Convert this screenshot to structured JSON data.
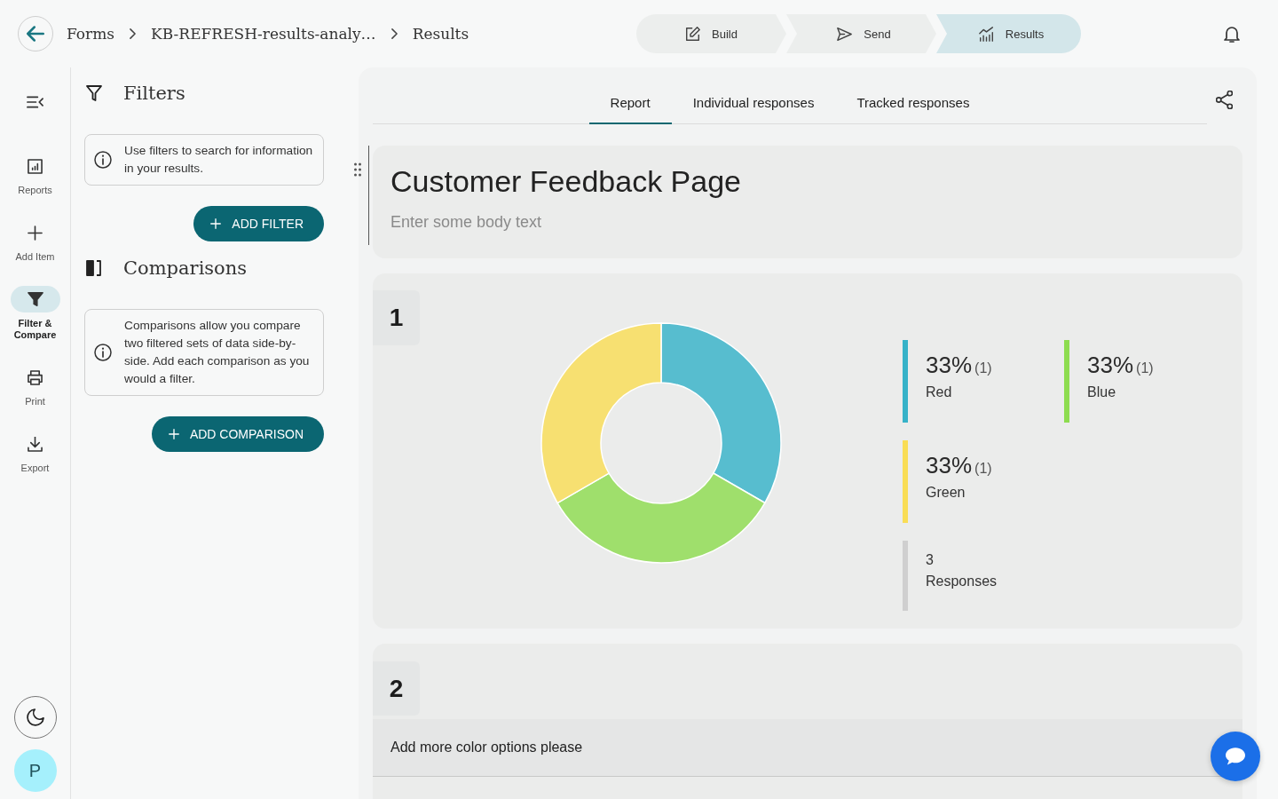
{
  "header": {
    "breadcrumbs": [
      "Forms",
      "KB-REFRESH-results-analy…",
      "Results"
    ],
    "steps": [
      {
        "label": "Build",
        "selected": false
      },
      {
        "label": "Send",
        "selected": false
      },
      {
        "label": "Results",
        "selected": true
      }
    ]
  },
  "rail": {
    "items": [
      {
        "label": "Reports",
        "selected": false
      },
      {
        "label": "Add Item",
        "selected": false
      },
      {
        "label": "Filter & Compare",
        "selected": true
      },
      {
        "label": "Print",
        "selected": false
      },
      {
        "label": "Export",
        "selected": false
      }
    ],
    "avatar": "P"
  },
  "filter_panel": {
    "sections": [
      {
        "title": "Filters",
        "info": "Use filters to search for information in your results.",
        "button": "ADD FILTER"
      },
      {
        "title": "Comparisons",
        "info": "Comparisons allow you compare two filtered sets of data side-by-side. Add each comparison as you would a filter.",
        "button": "ADD COMPARISON"
      }
    ]
  },
  "report": {
    "tabs": [
      {
        "label": "Report",
        "selected": true
      },
      {
        "label": "Individual responses",
        "selected": false
      },
      {
        "label": "Tracked responses",
        "selected": false
      }
    ],
    "title_card": {
      "title": "Customer Feedback Page",
      "placeholder": "Enter some body text"
    },
    "questions": [
      {
        "kind": "chart",
        "number": "1",
        "chart_data": {
          "type": "donut",
          "categories": [
            "Red",
            "Blue",
            "Green"
          ],
          "values": [
            33.33,
            33.33,
            33.34
          ]
        },
        "legend": [
          {
            "percent": "33%",
            "count": "(1)",
            "color": "#36b2c8"
          },
          {
            "percent": "33%",
            "count": "(1)",
            "color": "#8ddc4f"
          },
          {
            "percent": "33%",
            "count": "(1)",
            "color": "#f9dd55"
          }
        ],
        "total": {
          "count": "3",
          "label": "Responses"
        }
      },
      {
        "kind": "text",
        "number": "2",
        "responses": [
          "Add more color options please"
        ]
      }
    ]
  }
}
